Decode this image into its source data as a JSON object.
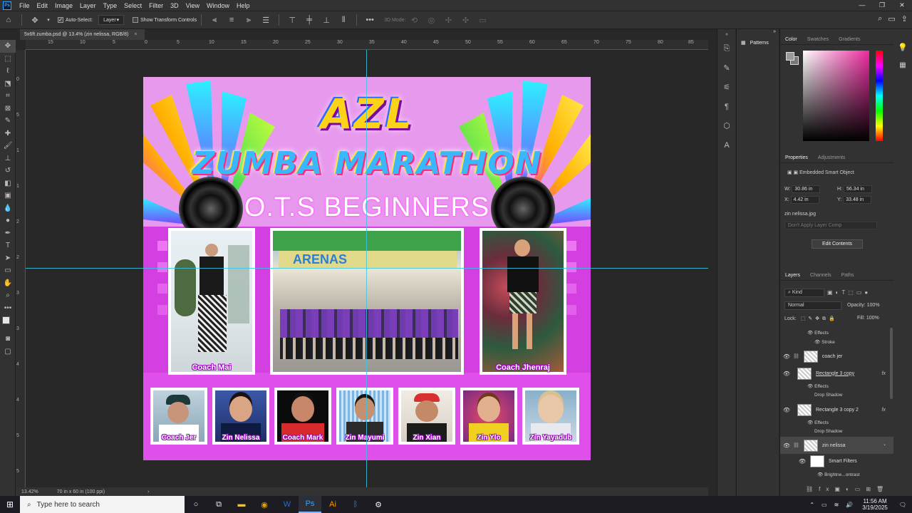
{
  "menubar": {
    "logo": "Ps",
    "items": [
      "File",
      "Edit",
      "Image",
      "Layer",
      "Type",
      "Select",
      "Filter",
      "3D",
      "View",
      "Window",
      "Help"
    ],
    "window_controls": [
      "—",
      "❐",
      "✕"
    ]
  },
  "options": {
    "auto_select_label": "Auto-Select:",
    "auto_select_target": "Layer",
    "show_transform_label": "Show Transform Controls",
    "mode_3d_label": "3D Mode:"
  },
  "document": {
    "tab_title": "5x6ft zumba.psd @ 13.4% (zin nelissa, RGB/8)",
    "close": "×"
  },
  "ruler": {
    "top_ticks": [
      "15",
      "10",
      "5",
      "0",
      "5",
      "10",
      "15",
      "20",
      "25",
      "30",
      "35",
      "40",
      "45",
      "50",
      "55",
      "60",
      "65",
      "70",
      "75",
      "80",
      "85"
    ],
    "left_ticks": [
      "0",
      "5",
      "1",
      "1",
      "2",
      "2",
      "3",
      "3",
      "4",
      "4",
      "5",
      "5"
    ]
  },
  "status": {
    "zoom": "13.42%",
    "doc_size": "70 in x 60 in (100 ppi)",
    "arrow": "›"
  },
  "poster": {
    "title_line1": "AZL",
    "title_line2": "ZUMBA MARATHON",
    "title_line3": "O.T.S BEGINNERS",
    "top_captions": [
      "Coach Mai",
      "",
      "Coach Jhenraj"
    ],
    "bottom_captions": [
      "Coach Jer",
      "Zin Nelissa",
      "Coach Mark",
      "Zin Mayumi",
      "Zin Xian",
      "Zin Ylo",
      "Zin Yayadub"
    ],
    "sign_text": "ARENAS"
  },
  "color_panel": {
    "tabs": [
      "Color",
      "Swatches",
      "Gradients"
    ],
    "hue_color": "#ee2aa0"
  },
  "patterns_label": "Patterns",
  "properties": {
    "tabs": [
      "Properties",
      "Adjustments"
    ],
    "type": "Embedded Smart Object",
    "w_label": "W:",
    "w_value": "30.86 in",
    "h_label": "H:",
    "h_value": "56.34 in",
    "x_label": "X:",
    "x_value": "4.42 in",
    "y_label": "Y:",
    "y_value": "33.48 in",
    "filename": "zin nelissa.jpg",
    "layer_comp_placeholder": "Don't Apply Layer Comp",
    "edit_button": "Edit Contents"
  },
  "layers": {
    "tabs": [
      "Layers",
      "Channels",
      "Paths"
    ],
    "filter": "Kind",
    "blend_mode": "Normal",
    "opacity_label": "Opacity:",
    "opacity_value": "100%",
    "lock_label": "Lock:",
    "fill_label": "Fill:",
    "fill_value": "100%",
    "items": [
      {
        "name": "Effects"
      },
      {
        "name": "Stroke"
      },
      {
        "name": "coach jer"
      },
      {
        "name": "Rectangle 3 copy"
      },
      {
        "name": "Effects"
      },
      {
        "name": "Drop Shadow"
      },
      {
        "name": "Rectangle 3 copy 2"
      },
      {
        "name": "Effects"
      },
      {
        "name": "Drop Shadow"
      },
      {
        "name": "zin nelissa"
      },
      {
        "name": "Smart Filters"
      },
      {
        "name": "Brightne...ontrast"
      }
    ],
    "fx": "fx"
  },
  "taskbar": {
    "search_placeholder": "Type here to search",
    "time": "11:56 AM",
    "date": "3/19/2025"
  }
}
